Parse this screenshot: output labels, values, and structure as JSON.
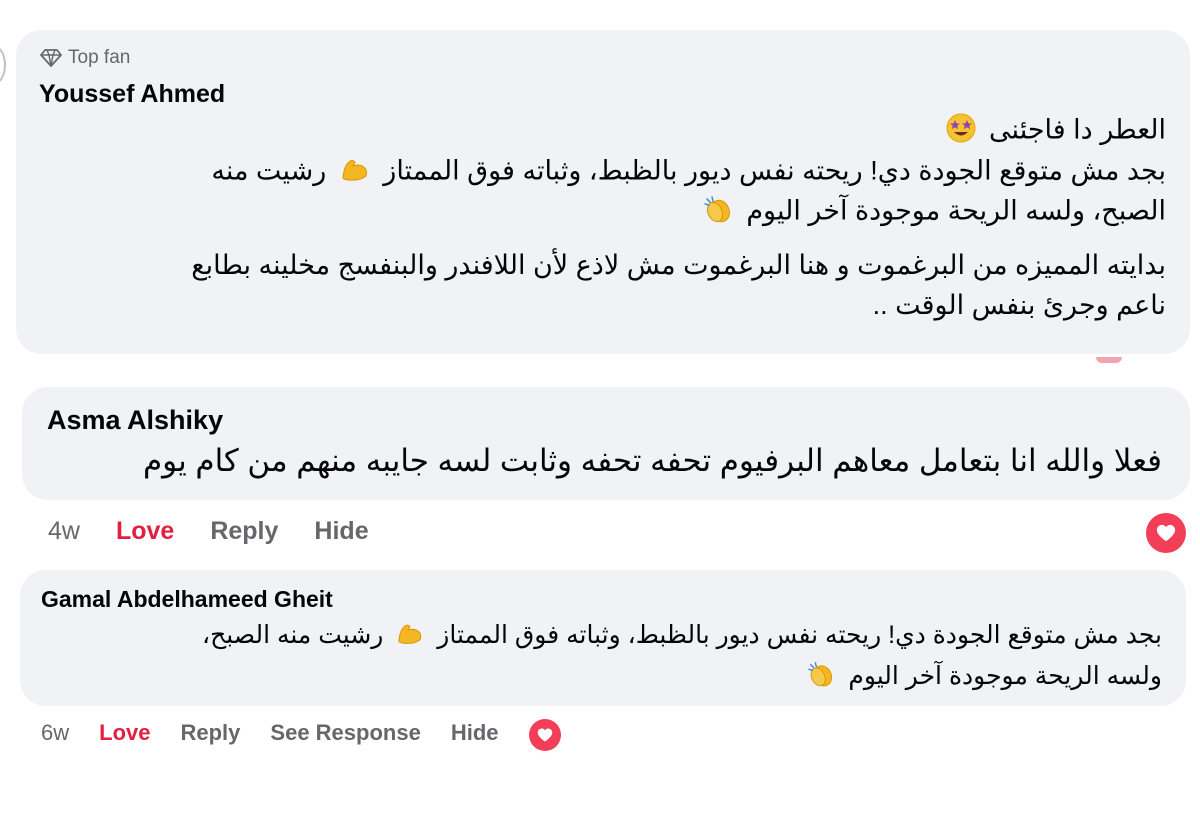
{
  "comments": [
    {
      "badge": "Top fan",
      "badge_icon": "diamond-icon",
      "author": "Youssef Ahmed",
      "lines": [
        "العطر دا فاجئنى",
        "بجد مش متوقع الجودة دي! ريحته نفس ديور بالظبط، وثباته فوق الممتاز",
        "الصبح، ولسه الريحة موجودة آخر اليوم",
        "بدايته المميزه من البرغموت و هنا البرغموت مش لاذع لأن اللافندر والبنفسج مخلينه بطابع",
        "ناعم وجرئ بنفس الوقت .."
      ],
      "line2_tail": "رشيت منه",
      "emojis": [
        "star-struck-emoji",
        "flexed-biceps-emoji",
        "clapping-hands-emoji"
      ]
    },
    {
      "author": "Asma Alshiky",
      "text": "فعلا والله انا بتعامل معاهم البرفيوم تحفه تحفه وثابت لسه جايبه منهم من كام يوم",
      "actions": {
        "time": "4w",
        "love": "Love",
        "reply": "Reply",
        "hide": "Hide"
      },
      "reaction": "heart-reaction-icon"
    },
    {
      "author": "Gamal Abdelhameed Gheit",
      "lines": [
        "بجد مش متوقع الجودة دي! ريحته نفس ديور بالظبط، وثباته فوق الممتاز",
        "ولسه الريحة موجودة آخر اليوم"
      ],
      "line1_tail": "رشيت منه الصبح،",
      "emojis": [
        "flexed-biceps-emoji",
        "clapping-hands-emoji"
      ],
      "actions": {
        "time": "6w",
        "love": "Love",
        "reply": "Reply",
        "see_response": "See Response",
        "hide": "Hide"
      },
      "reaction": "heart-reaction-icon"
    }
  ],
  "colors": {
    "bubble_bg": "#f0f2f5",
    "love": "#e41e3f",
    "muted": "#65676b",
    "reaction": "#f33e58"
  }
}
